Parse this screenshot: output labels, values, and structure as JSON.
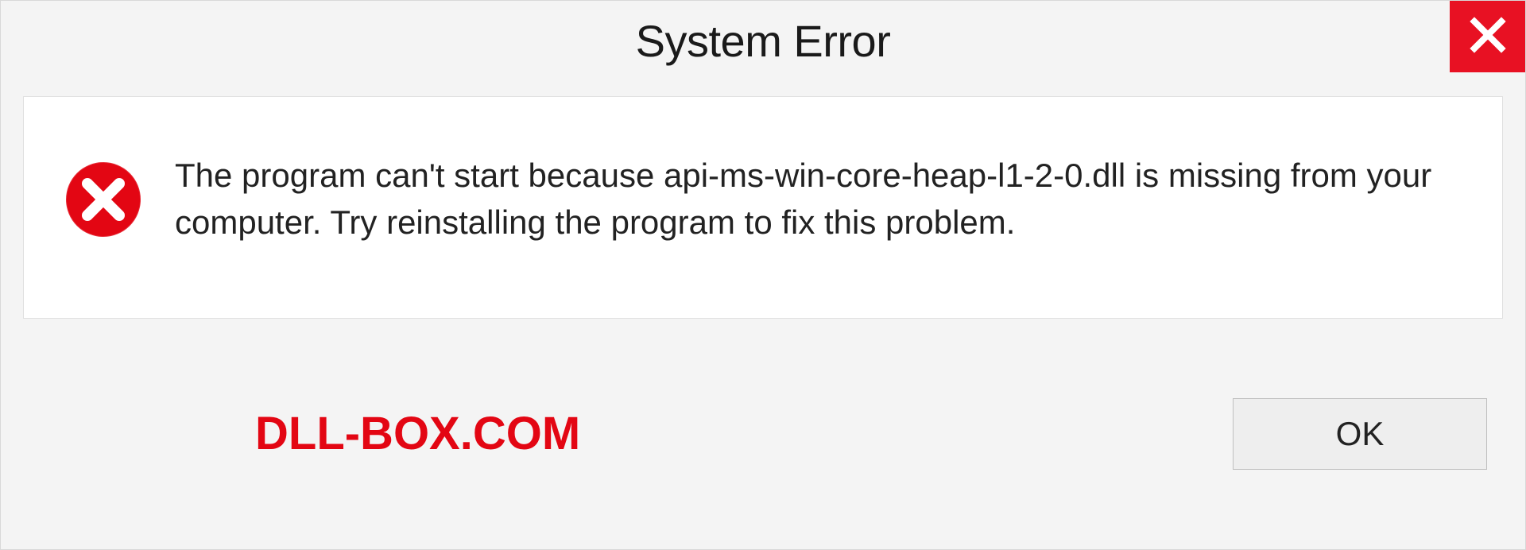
{
  "dialog": {
    "title": "System Error",
    "message": "The program can't start because api-ms-win-core-heap-l1-2-0.dll is missing from your computer. Try reinstalling the program to fix this problem.",
    "ok_label": "OK",
    "watermark": "DLL-BOX.COM"
  }
}
